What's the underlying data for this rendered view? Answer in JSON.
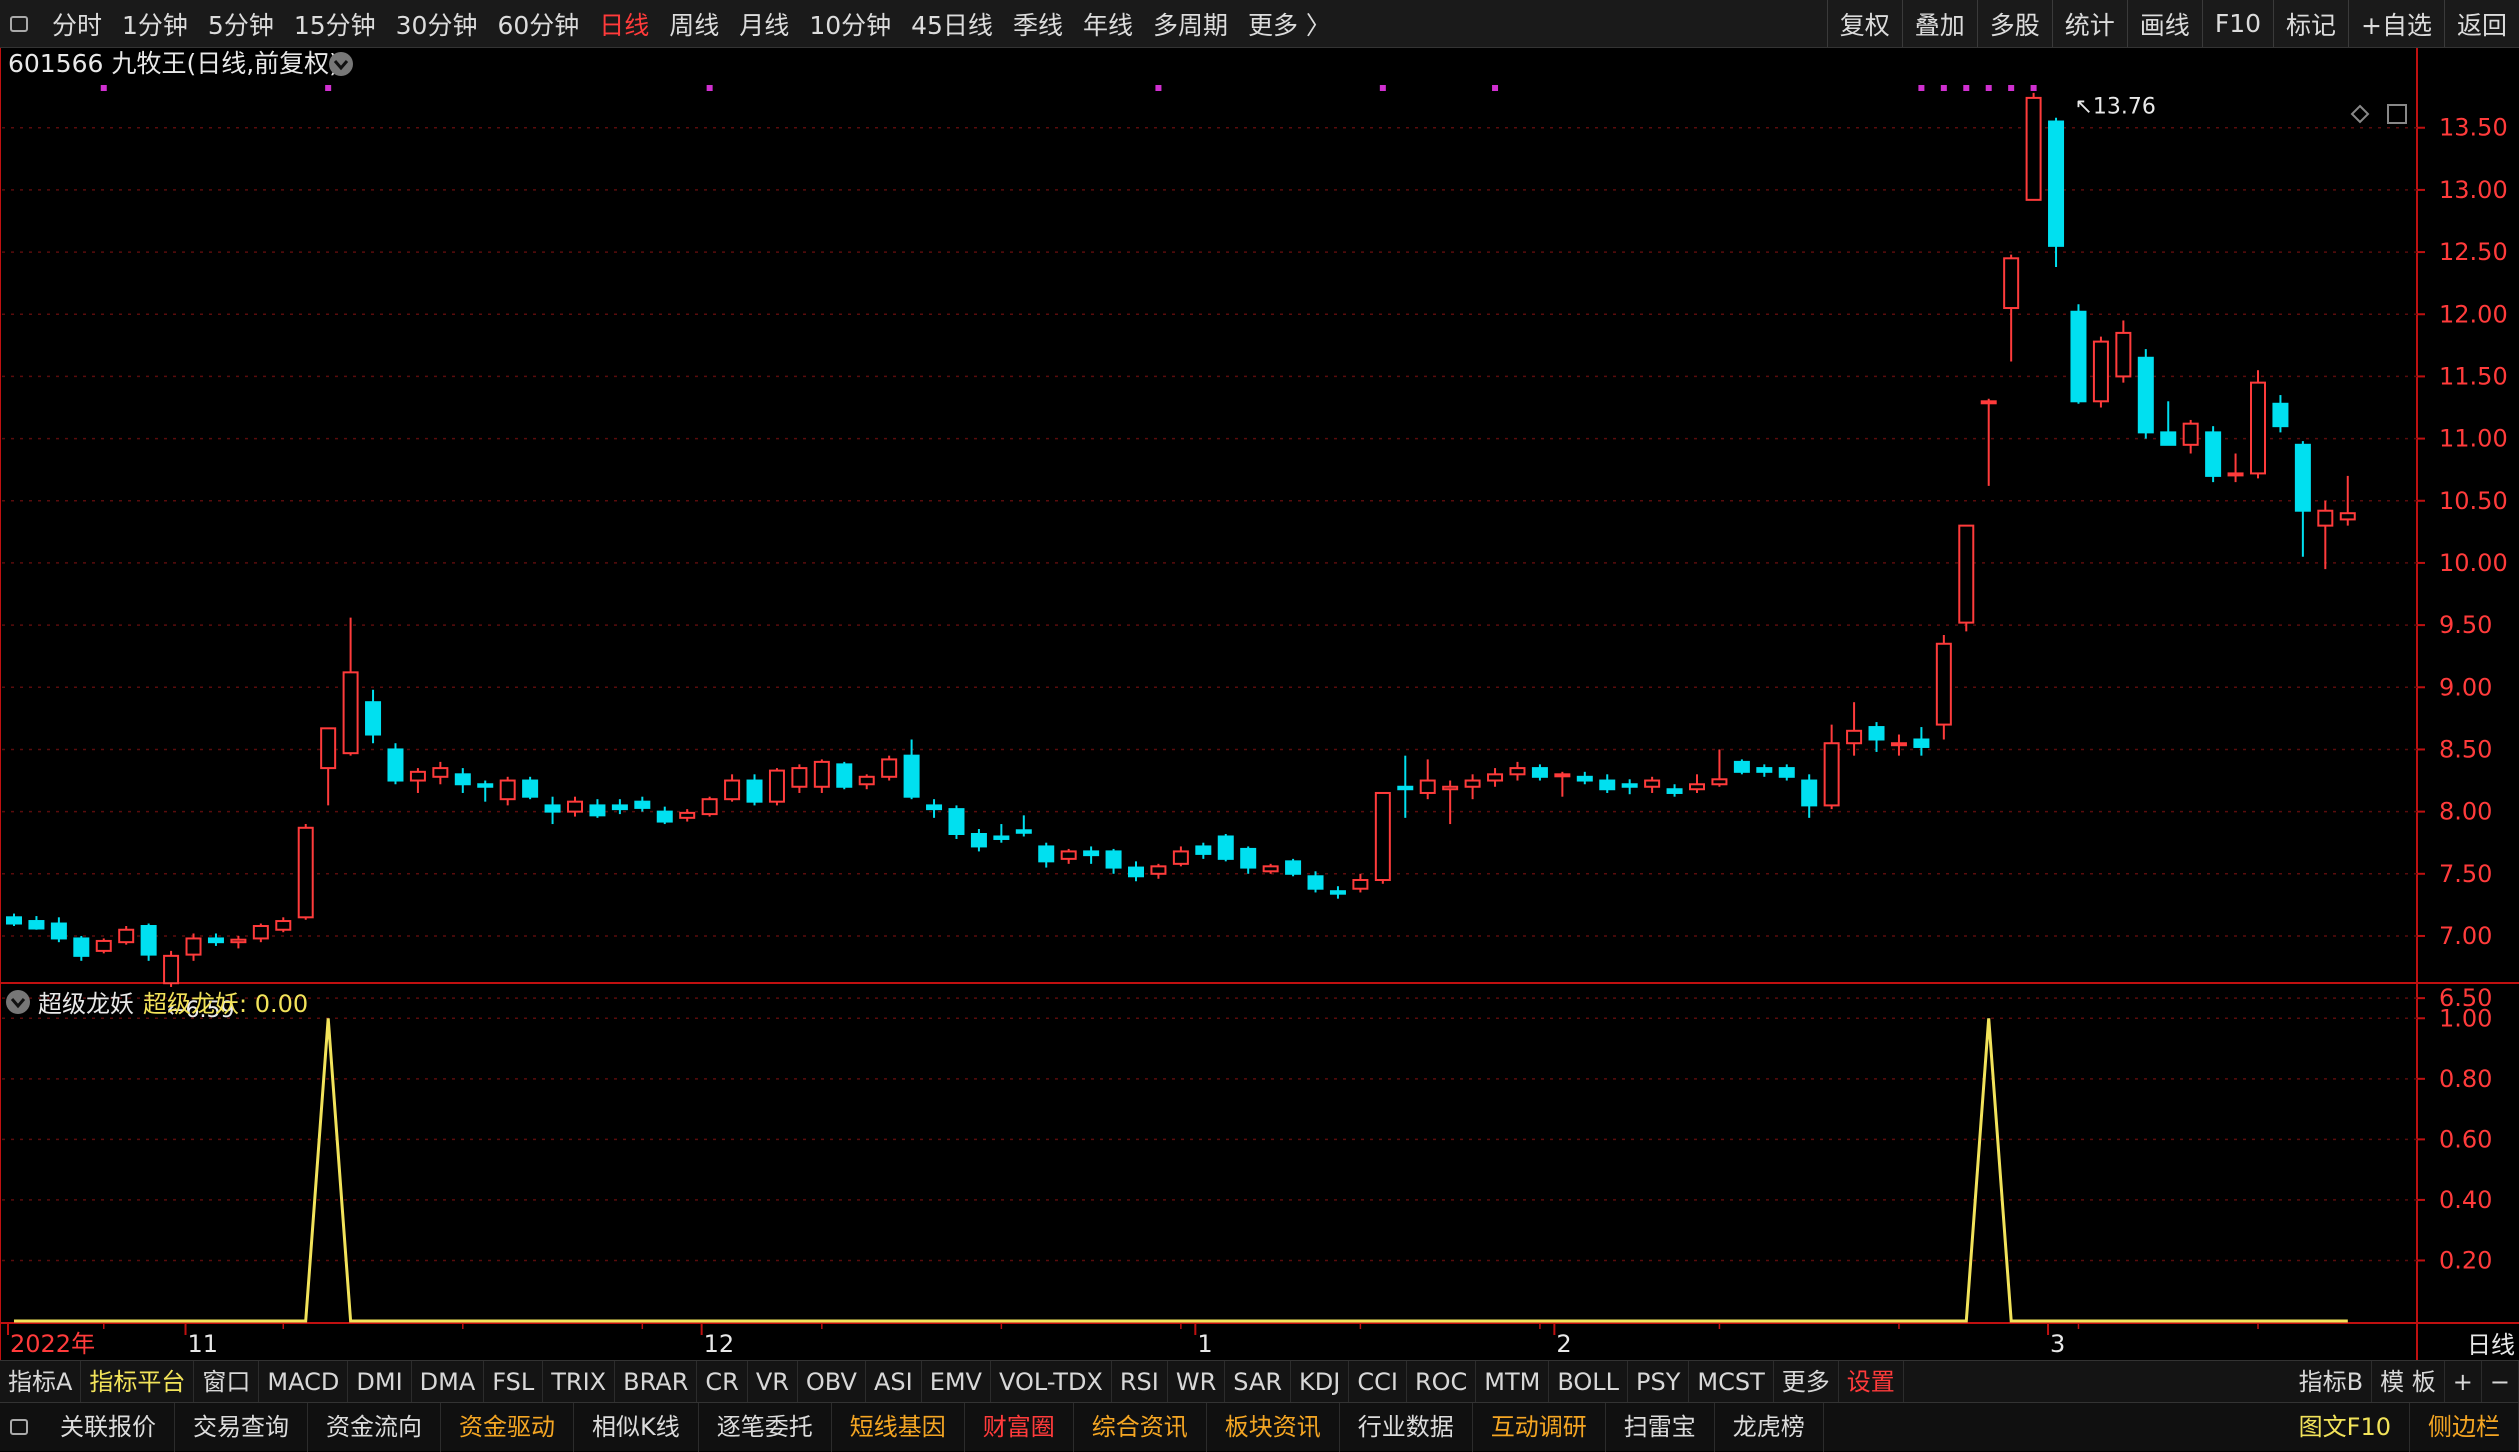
{
  "topbar": {
    "periods": [
      {
        "label": "分时",
        "active": false
      },
      {
        "label": "1分钟",
        "active": false
      },
      {
        "label": "5分钟",
        "active": false
      },
      {
        "label": "15分钟",
        "active": false
      },
      {
        "label": "30分钟",
        "active": false
      },
      {
        "label": "60分钟",
        "active": false
      },
      {
        "label": "日线",
        "active": true
      },
      {
        "label": "周线",
        "active": false
      },
      {
        "label": "月线",
        "active": false
      },
      {
        "label": "10分钟",
        "active": false
      },
      {
        "label": "45日线",
        "active": false
      },
      {
        "label": "季线",
        "active": false
      },
      {
        "label": "年线",
        "active": false
      },
      {
        "label": "多周期",
        "active": false
      },
      {
        "label": "更多 〉",
        "active": false
      }
    ],
    "tools": [
      "复权",
      "叠加",
      "多股",
      "统计",
      "画线",
      "F10",
      "标记",
      "+自选",
      "返回"
    ]
  },
  "stock": {
    "code": "601566",
    "name": "九牧王",
    "mode": "(日线,前复权)"
  },
  "colors": {
    "up": "#ff3b3b",
    "down": "#00e0f0",
    "grid": "#5a0c0c",
    "axis": "#c01010",
    "indicator": "#f2e35a",
    "marker": "#d030d0",
    "label": "#dcdcdc"
  },
  "chart_data": [
    {
      "type": "candlestick",
      "title": "601566 九牧王 (日线,前复权)",
      "price_axis": {
        "ylim": [
          6.3,
          13.9
        ],
        "ticks": [
          "13.50",
          "13.00",
          "12.50",
          "12.00",
          "11.50",
          "11.00",
          "10.50",
          "10.00",
          "9.50",
          "9.00",
          "8.50",
          "8.00",
          "7.50",
          "7.00",
          "6.50"
        ]
      },
      "period_label": "日线",
      "date_axis": [
        {
          "label": "2022年",
          "bar": 0,
          "color": "red"
        },
        {
          "label": "11",
          "bar": 8,
          "color": "white"
        },
        {
          "label": "12",
          "bar": 31,
          "color": "white"
        },
        {
          "label": "1",
          "bar": 53,
          "color": "white"
        },
        {
          "label": "2",
          "bar": 69,
          "color": "white"
        },
        {
          "label": "3",
          "bar": 91,
          "color": "white"
        }
      ],
      "annotations": [
        {
          "text": "←6.59",
          "bar": 7,
          "price": 6.59
        },
        {
          "text": "↖13.76",
          "bar": 92,
          "price": 13.76
        }
      ],
      "markers_top": [
        4,
        14,
        31,
        51,
        61,
        66,
        85,
        86,
        87,
        88,
        89,
        90
      ],
      "candles": [
        {
          "o": 7.15,
          "h": 7.18,
          "l": 7.08,
          "c": 7.1
        },
        {
          "o": 7.12,
          "h": 7.16,
          "l": 7.05,
          "c": 7.06
        },
        {
          "o": 7.1,
          "h": 7.15,
          "l": 6.95,
          "c": 6.98
        },
        {
          "o": 6.98,
          "h": 7.0,
          "l": 6.8,
          "c": 6.84
        },
        {
          "o": 6.88,
          "h": 6.98,
          "l": 6.86,
          "c": 6.96
        },
        {
          "o": 6.95,
          "h": 7.08,
          "l": 6.93,
          "c": 7.05
        },
        {
          "o": 7.08,
          "h": 7.1,
          "l": 6.8,
          "c": 6.85
        },
        {
          "o": 6.62,
          "h": 6.88,
          "l": 6.59,
          "c": 6.84
        },
        {
          "o": 6.85,
          "h": 7.02,
          "l": 6.8,
          "c": 6.98
        },
        {
          "o": 6.98,
          "h": 7.02,
          "l": 6.92,
          "c": 6.95
        },
        {
          "o": 6.95,
          "h": 7.0,
          "l": 6.9,
          "c": 6.97
        },
        {
          "o": 6.98,
          "h": 7.1,
          "l": 6.95,
          "c": 7.08
        },
        {
          "o": 7.05,
          "h": 7.15,
          "l": 7.03,
          "c": 7.12
        },
        {
          "o": 7.15,
          "h": 7.9,
          "l": 7.13,
          "c": 7.87
        },
        {
          "o": 8.35,
          "h": 8.67,
          "l": 8.05,
          "c": 8.67
        },
        {
          "o": 8.47,
          "h": 9.56,
          "l": 8.45,
          "c": 9.12
        },
        {
          "o": 8.88,
          "h": 8.98,
          "l": 8.55,
          "c": 8.62
        },
        {
          "o": 8.5,
          "h": 8.55,
          "l": 8.22,
          "c": 8.25
        },
        {
          "o": 8.25,
          "h": 8.35,
          "l": 8.15,
          "c": 8.32
        },
        {
          "o": 8.28,
          "h": 8.4,
          "l": 8.22,
          "c": 8.35
        },
        {
          "o": 8.3,
          "h": 8.35,
          "l": 8.15,
          "c": 8.22
        },
        {
          "o": 8.22,
          "h": 8.25,
          "l": 8.08,
          "c": 8.2
        },
        {
          "o": 8.1,
          "h": 8.28,
          "l": 8.05,
          "c": 8.25
        },
        {
          "o": 8.25,
          "h": 8.28,
          "l": 8.1,
          "c": 8.12
        },
        {
          "o": 8.05,
          "h": 8.12,
          "l": 7.9,
          "c": 8.0
        },
        {
          "o": 8.0,
          "h": 8.12,
          "l": 7.96,
          "c": 8.08
        },
        {
          "o": 8.05,
          "h": 8.1,
          "l": 7.95,
          "c": 7.97
        },
        {
          "o": 8.05,
          "h": 8.1,
          "l": 7.98,
          "c": 8.02
        },
        {
          "o": 8.08,
          "h": 8.12,
          "l": 8.0,
          "c": 8.03
        },
        {
          "o": 8.0,
          "h": 8.04,
          "l": 7.9,
          "c": 7.92
        },
        {
          "o": 7.95,
          "h": 8.02,
          "l": 7.92,
          "c": 7.99
        },
        {
          "o": 7.98,
          "h": 8.12,
          "l": 7.96,
          "c": 8.1
        },
        {
          "o": 8.1,
          "h": 8.3,
          "l": 8.08,
          "c": 8.25
        },
        {
          "o": 8.25,
          "h": 8.3,
          "l": 8.05,
          "c": 8.08
        },
        {
          "o": 8.08,
          "h": 8.35,
          "l": 8.05,
          "c": 8.33
        },
        {
          "o": 8.2,
          "h": 8.38,
          "l": 8.15,
          "c": 8.35
        },
        {
          "o": 8.2,
          "h": 8.42,
          "l": 8.15,
          "c": 8.4
        },
        {
          "o": 8.38,
          "h": 8.4,
          "l": 8.18,
          "c": 8.2
        },
        {
          "o": 8.22,
          "h": 8.3,
          "l": 8.18,
          "c": 8.28
        },
        {
          "o": 8.28,
          "h": 8.45,
          "l": 8.25,
          "c": 8.42
        },
        {
          "o": 8.45,
          "h": 8.58,
          "l": 8.1,
          "c": 8.12
        },
        {
          "o": 8.05,
          "h": 8.1,
          "l": 7.95,
          "c": 8.02
        },
        {
          "o": 8.02,
          "h": 8.05,
          "l": 7.78,
          "c": 7.82
        },
        {
          "o": 7.82,
          "h": 7.86,
          "l": 7.68,
          "c": 7.72
        },
        {
          "o": 7.8,
          "h": 7.9,
          "l": 7.75,
          "c": 7.78
        },
        {
          "o": 7.85,
          "h": 7.97,
          "l": 7.8,
          "c": 7.83
        },
        {
          "o": 7.72,
          "h": 7.75,
          "l": 7.55,
          "c": 7.6
        },
        {
          "o": 7.62,
          "h": 7.7,
          "l": 7.58,
          "c": 7.68
        },
        {
          "o": 7.68,
          "h": 7.72,
          "l": 7.58,
          "c": 7.65
        },
        {
          "o": 7.68,
          "h": 7.7,
          "l": 7.5,
          "c": 7.55
        },
        {
          "o": 7.55,
          "h": 7.6,
          "l": 7.44,
          "c": 7.48
        },
        {
          "o": 7.5,
          "h": 7.58,
          "l": 7.46,
          "c": 7.56
        },
        {
          "o": 7.58,
          "h": 7.72,
          "l": 7.56,
          "c": 7.68
        },
        {
          "o": 7.72,
          "h": 7.75,
          "l": 7.62,
          "c": 7.66
        },
        {
          "o": 7.8,
          "h": 7.82,
          "l": 7.6,
          "c": 7.62
        },
        {
          "o": 7.7,
          "h": 7.72,
          "l": 7.5,
          "c": 7.55
        },
        {
          "o": 7.52,
          "h": 7.58,
          "l": 7.5,
          "c": 7.56
        },
        {
          "o": 7.6,
          "h": 7.62,
          "l": 7.48,
          "c": 7.5
        },
        {
          "o": 7.48,
          "h": 7.52,
          "l": 7.35,
          "c": 7.38
        },
        {
          "o": 7.36,
          "h": 7.4,
          "l": 7.3,
          "c": 7.34
        },
        {
          "o": 7.38,
          "h": 7.5,
          "l": 7.35,
          "c": 7.45
        },
        {
          "o": 7.45,
          "h": 8.15,
          "l": 7.42,
          "c": 8.15
        },
        {
          "o": 8.2,
          "h": 8.45,
          "l": 7.95,
          "c": 8.18
        },
        {
          "o": 8.15,
          "h": 8.42,
          "l": 8.1,
          "c": 8.25
        },
        {
          "o": 8.18,
          "h": 8.25,
          "l": 7.9,
          "c": 8.2
        },
        {
          "o": 8.2,
          "h": 8.3,
          "l": 8.1,
          "c": 8.25
        },
        {
          "o": 8.25,
          "h": 8.35,
          "l": 8.2,
          "c": 8.3
        },
        {
          "o": 8.3,
          "h": 8.4,
          "l": 8.25,
          "c": 8.35
        },
        {
          "o": 8.35,
          "h": 8.38,
          "l": 8.25,
          "c": 8.28
        },
        {
          "o": 8.3,
          "h": 8.32,
          "l": 8.12,
          "c": 8.3
        },
        {
          "o": 8.28,
          "h": 8.32,
          "l": 8.22,
          "c": 8.25
        },
        {
          "o": 8.25,
          "h": 8.3,
          "l": 8.15,
          "c": 8.18
        },
        {
          "o": 8.22,
          "h": 8.26,
          "l": 8.14,
          "c": 8.2
        },
        {
          "o": 8.2,
          "h": 8.28,
          "l": 8.15,
          "c": 8.25
        },
        {
          "o": 8.18,
          "h": 8.22,
          "l": 8.12,
          "c": 8.15
        },
        {
          "o": 8.18,
          "h": 8.3,
          "l": 8.15,
          "c": 8.22
        },
        {
          "o": 8.22,
          "h": 8.5,
          "l": 8.2,
          "c": 8.26
        },
        {
          "o": 8.4,
          "h": 8.42,
          "l": 8.3,
          "c": 8.32
        },
        {
          "o": 8.35,
          "h": 8.38,
          "l": 8.28,
          "c": 8.32
        },
        {
          "o": 8.35,
          "h": 8.38,
          "l": 8.25,
          "c": 8.28
        },
        {
          "o": 8.25,
          "h": 8.3,
          "l": 7.95,
          "c": 8.05
        },
        {
          "o": 8.05,
          "h": 8.7,
          "l": 8.02,
          "c": 8.55
        },
        {
          "o": 8.55,
          "h": 8.88,
          "l": 8.45,
          "c": 8.65
        },
        {
          "o": 8.68,
          "h": 8.72,
          "l": 8.48,
          "c": 8.58
        },
        {
          "o": 8.55,
          "h": 8.62,
          "l": 8.45,
          "c": 8.55
        },
        {
          "o": 8.58,
          "h": 8.68,
          "l": 8.45,
          "c": 8.52
        },
        {
          "o": 8.7,
          "h": 9.42,
          "l": 8.58,
          "c": 9.35
        },
        {
          "o": 9.52,
          "h": 10.3,
          "l": 9.45,
          "c": 10.3
        },
        {
          "o": 11.3,
          "h": 11.32,
          "l": 10.62,
          "c": 11.3
        },
        {
          "o": 12.05,
          "h": 12.48,
          "l": 11.62,
          "c": 12.45
        },
        {
          "o": 12.92,
          "h": 13.78,
          "l": 12.92,
          "c": 13.74
        },
        {
          "o": 13.55,
          "h": 13.58,
          "l": 12.38,
          "c": 12.55
        },
        {
          "o": 12.02,
          "h": 12.08,
          "l": 11.28,
          "c": 11.3
        },
        {
          "o": 11.3,
          "h": 11.82,
          "l": 11.25,
          "c": 11.78
        },
        {
          "o": 11.5,
          "h": 11.95,
          "l": 11.45,
          "c": 11.85
        },
        {
          "o": 11.65,
          "h": 11.72,
          "l": 11.0,
          "c": 11.05
        },
        {
          "o": 11.05,
          "h": 11.3,
          "l": 10.95,
          "c": 10.95
        },
        {
          "o": 10.95,
          "h": 11.15,
          "l": 10.88,
          "c": 11.12
        },
        {
          "o": 11.05,
          "h": 11.1,
          "l": 10.65,
          "c": 10.7
        },
        {
          "o": 10.72,
          "h": 10.88,
          "l": 10.65,
          "c": 10.72
        },
        {
          "o": 10.72,
          "h": 11.55,
          "l": 10.68,
          "c": 11.45
        },
        {
          "o": 11.28,
          "h": 11.35,
          "l": 11.05,
          "c": 11.1
        },
        {
          "o": 10.95,
          "h": 10.98,
          "l": 10.05,
          "c": 10.42
        },
        {
          "o": 10.3,
          "h": 10.5,
          "l": 9.95,
          "c": 10.42
        },
        {
          "o": 10.35,
          "h": 10.7,
          "l": 10.3,
          "c": 10.4
        }
      ]
    },
    {
      "type": "line",
      "name": "超级龙妖",
      "header_value": "超级龙妖: 0.00",
      "ylim": [
        0,
        1.1
      ],
      "ticks": [
        "1.00",
        "0.80",
        "0.60",
        "0.40",
        "0.20"
      ],
      "spikes": [
        {
          "bar": 14,
          "value": 1.0
        },
        {
          "bar": 88,
          "value": 1.0
        }
      ]
    }
  ],
  "indicator_tabs": [
    "指标A",
    "指标平台",
    "窗口",
    "MACD",
    "DMI",
    "DMA",
    "FSL",
    "TRIX",
    "BRAR",
    "CR",
    "VR",
    "OBV",
    "ASI",
    "EMV",
    "VOL-TDX",
    "RSI",
    "WR",
    "SAR",
    "KDJ",
    "CCI",
    "ROC",
    "MTM",
    "BOLL",
    "PSY",
    "MCST",
    "更多",
    "设置"
  ],
  "indicator_tabs_right": [
    "指标B",
    "模 板",
    "+",
    "−"
  ],
  "bottom_tabs": [
    {
      "label": "关联报价",
      "color": "white"
    },
    {
      "label": "交易查询",
      "color": "white"
    },
    {
      "label": "资金流向",
      "color": "white"
    },
    {
      "label": "资金驱动",
      "color": "orange"
    },
    {
      "label": "相似K线",
      "color": "white"
    },
    {
      "label": "逐笔委托",
      "color": "white"
    },
    {
      "label": "短线基因",
      "color": "orange"
    },
    {
      "label": "财富圈",
      "color": "red"
    },
    {
      "label": "综合资讯",
      "color": "orange"
    },
    {
      "label": "板块资讯",
      "color": "orange"
    },
    {
      "label": "行业数据",
      "color": "white"
    },
    {
      "label": "互动调研",
      "color": "orange"
    },
    {
      "label": "扫雷宝",
      "color": "white"
    },
    {
      "label": "龙虎榜",
      "color": "white"
    }
  ],
  "bottom_right": [
    {
      "label": "图文F10",
      "color": "yellow"
    },
    {
      "label": "侧边栏",
      "color": "orange"
    }
  ]
}
